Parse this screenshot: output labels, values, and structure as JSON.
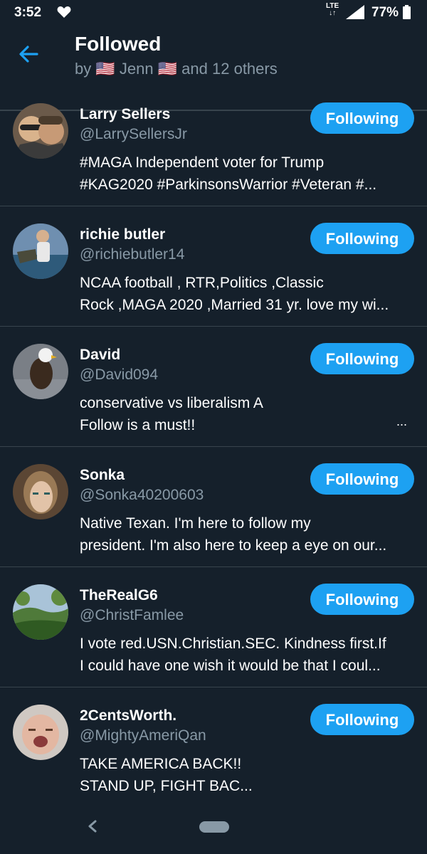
{
  "status_bar": {
    "time": "3:52",
    "network": "LTE",
    "battery": "77%",
    "icons": [
      "heart-icon",
      "signal-icon",
      "battery-icon"
    ]
  },
  "header": {
    "title": "Followed",
    "subtitle": "by 🇺🇸 Jenn 🇺🇸 and 12 others",
    "back_icon": "arrow-left-icon"
  },
  "colors": {
    "background": "#15202b",
    "accent": "#1da1f2",
    "secondary_text": "#8899a6",
    "divider": "#38444d"
  },
  "users": [
    {
      "name": "Larry Sellers",
      "handle": "@LarrySellersJr",
      "bio_line1": "#MAGA Independent voter for Trump",
      "bio_line2": "#KAG2020 #ParkinsonsWarrior #Veteran #...",
      "button": "Following"
    },
    {
      "name": "richie butler",
      "handle": "@richiebutler14",
      "bio_line1": "NCAA football , RTR,Politics ,Classic",
      "bio_line2": "Rock ,MAGA 2020 ,Married 31 yr. love my wi...",
      "button": "Following"
    },
    {
      "name": "David",
      "handle": "@David094",
      "bio_line1": "conservative vs liberalism   A",
      "bio_line2": "Follow is a must!!",
      "bio_suffix": "...",
      "button": "Following"
    },
    {
      "name": "Sonka",
      "handle": "@Sonka40200603",
      "bio_line1": "Native Texan. I'm here to follow my",
      "bio_line2": "president. I'm also here to keep a eye on our...",
      "button": "Following"
    },
    {
      "name": "TheRealG6",
      "handle": "@ChristFamlee",
      "bio_line1": "I vote red.USN.Christian.SEC. Kindness first.If",
      "bio_line2": "I could have one wish it would be that I coul...",
      "button": "Following"
    },
    {
      "name": "2CentsWorth.",
      "handle": "@MightyAmeriQan",
      "bio_line1": "TAKE AMERICA BACK!!",
      "bio_line2": "STAND UP, FIGHT BAC...",
      "button": "Following"
    }
  ],
  "nav_bar": {
    "icons": [
      "nav-back-icon",
      "home-pill-icon"
    ]
  }
}
